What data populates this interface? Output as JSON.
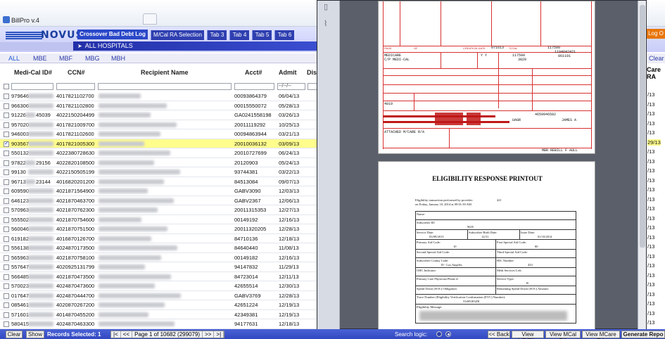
{
  "window": {
    "title": "BillPro v.4"
  },
  "header": {
    "logo_text": "NOVUS",
    "active_tab": "Crossover Bad Debt Log",
    "tabs": [
      "M/Cal RA Selection",
      "Tab 3",
      "Tab 4",
      "Tab 5",
      "Tab 6"
    ],
    "scope": "ALL HOSPITALS",
    "logout": "Log O"
  },
  "subtabs": [
    "ALL",
    "MBE",
    "MBF",
    "MBG",
    "MBH"
  ],
  "table": {
    "headers": [
      "Medi-Cal ID#",
      "CCN#",
      "Recipient Name",
      "Acct#",
      "Admit",
      "Dis"
    ],
    "filter_placeholder": "--/--/--",
    "rows": [
      {
        "id": "979646",
        "ccn": "4017821102700",
        "acct": "00093864379",
        "admit": "06/04/13",
        "checked": false
      },
      {
        "id": "966306",
        "ccn": "4017821102800",
        "acct": "00015550072",
        "admit": "05/28/13",
        "checked": false
      },
      {
        "id": "91226",
        "id2": "45039",
        "ccn": "4022150204499",
        "acct": "GA0241558198",
        "admit": "03/26/13",
        "checked": false
      },
      {
        "id": "957020",
        "ccn": "4017821009700",
        "acct": "20011119292",
        "admit": "10/25/13",
        "checked": false
      },
      {
        "id": "946003",
        "ccn": "4017821102600",
        "acct": "00094863944",
        "admit": "03/21/13",
        "checked": false
      },
      {
        "id": "903567",
        "ccn": "4017821005300",
        "acct": "20010036132",
        "admit": "03/09/13",
        "checked": true
      },
      {
        "id": "550132",
        "ccn": "4022380728630",
        "acct": "20010727699",
        "admit": "06/24/13",
        "checked": false
      },
      {
        "id": "97822",
        "id2": "29156",
        "ccn": "4022820108500",
        "acct": "20120903",
        "admit": "05/24/13",
        "checked": false
      },
      {
        "id": "99130",
        "ccn": "4022150505199",
        "acct": "93744381",
        "admit": "03/22/13",
        "checked": false
      },
      {
        "id": "96713",
        "id2": "23144",
        "ccn": "4016820201200",
        "acct": "84513084",
        "admit": "09/07/13",
        "checked": false
      },
      {
        "id": "609590",
        "ccn": "4021871564900",
        "acct": "GABV3090",
        "admit": "12/03/13",
        "checked": false
      },
      {
        "id": "646123",
        "ccn": "4021870463700",
        "acct": "GABV2367",
        "admit": "12/06/13",
        "checked": false
      },
      {
        "id": "570963",
        "ccn": "4021870762300",
        "acct": "20011315353",
        "admit": "12/27/13",
        "checked": false
      },
      {
        "id": "555502",
        "ccn": "4021870754600",
        "acct": "00149192",
        "admit": "12/16/13",
        "checked": false
      },
      {
        "id": "560046",
        "ccn": "4021870751500",
        "acct": "20011320205",
        "admit": "12/28/13",
        "checked": false
      },
      {
        "id": "619182",
        "ccn": "4016870126700",
        "acct": "84710136",
        "admit": "12/18/13",
        "checked": false
      },
      {
        "id": "556138",
        "ccn": "4024870173500",
        "acct": "84640440",
        "admit": "11/08/13",
        "checked": false
      },
      {
        "id": "565963",
        "ccn": "4021870758100",
        "acct": "00149182",
        "admit": "12/16/13",
        "checked": false
      },
      {
        "id": "557647",
        "ccn": "4020925131799",
        "acct": "94147832",
        "admit": "11/29/13",
        "checked": false
      },
      {
        "id": "566485",
        "ccn": "4021870473500",
        "acct": "84723014",
        "admit": "12/11/13",
        "checked": false
      },
      {
        "id": "570023",
        "ccn": "4024870473600",
        "acct": "42655514",
        "admit": "12/30/13",
        "checked": false
      },
      {
        "id": "017647",
        "ccn": "4024870444700",
        "acct": "GABV3769",
        "admit": "12/28/13",
        "checked": false
      },
      {
        "id": "085461",
        "ccn": "4020870267200",
        "acct": "42651224",
        "admit": "12/19/13",
        "checked": false
      },
      {
        "id": "571601",
        "ccn": "4014870455200",
        "acct": "42349381",
        "admit": "12/19/13",
        "checked": false
      },
      {
        "id": "580415",
        "ccn": "4024870463300",
        "acct": "94177631",
        "admit": "12/18/13",
        "checked": false
      }
    ]
  },
  "right_column": {
    "header_lines": [
      "Care",
      "RA"
    ],
    "values": [
      "/13",
      "/13",
      "/13",
      "/13",
      "/13",
      "29/13",
      "/13",
      "/13",
      "/13",
      "/13",
      "/13",
      "/13",
      "/13",
      "/13",
      "/13",
      "/13",
      "/13",
      "/13",
      "/13",
      "/13",
      "/13",
      "/13",
      "/13",
      "/13",
      "/13"
    ]
  },
  "pdf": {
    "claim": {
      "payer_line1": "MEDICARE",
      "payer_line2": "C/P MEDI-CAL",
      "creation_date_label": "CREATION DATE",
      "creation_date": "071613",
      "total_label": "TOTAL",
      "amount1": "117500",
      "amount2": "117500",
      "amount3": "3820",
      "npi": "1194842421",
      "code1": "061191",
      "code2": "4659946582",
      "code3": "4019",
      "provider": "UAGR",
      "name_short": "JAMES A",
      "attached": "ATTACHED M/CARE R/A",
      "rebill": "MBR REBILL F AULL"
    },
    "eligibility": {
      "title": "ELIGIBILITY RESPONSE PRINTOUT",
      "performed_by": "Eligibility transaction performed by provider:",
      "provider_no": "421",
      "performed_on": "on Friday, January 10, 2014 at 09:01:39 AM",
      "name_label": "Name:",
      "subscriber_id_label": "Subscriber ID:",
      "subscriber_id": "9635",
      "service_date_label": "Service Date:",
      "service_date": "03/09/2013",
      "birth_date_label": "Subscriber Birth Date:",
      "birth_date": "12/31",
      "issue_date_label": "Issue Date:",
      "issue_date": "01/10/2014",
      "primary_aid_label": "Primary Aid Code:",
      "primary_aid": "10",
      "first_special_label": "First Special Aid Code:",
      "first_special": "80",
      "second_special_label": "Second Special Aid Code:",
      "third_special_label": "Third Special Aid Code:",
      "county_label": "Subscriber County Code:",
      "county": "19 - Los Angeles",
      "hic_label": "HIC Number:",
      "hic": "433",
      "ohc_label": "OHC Indicator:",
      "medi_services_label": "Medi Services Left:",
      "pcp_label": "Primary Care Physician Phone #:",
      "service_type_label": "Service Type:",
      "service_type": "R",
      "soc_label": "Spend Down (SOC) Obligation:",
      "remaining_soc_label": "Remaining Spend Down (SOC) Amount:",
      "trace_label": "Trace Number (Eligibility Verification Confirmation (EVC) Number):",
      "trace": "53495J03ZB",
      "message_label": "Eligibility Message:"
    }
  },
  "bottom": {
    "clear": "Clear",
    "show": "Show",
    "records_selected": "Records Selected: 1",
    "pager_first": "|<",
    "pager_prev": "<<",
    "page_info": "Page 1 of 10682 (299079)",
    "pager_next": ">>",
    "pager_last": ">|",
    "search_logic": "Search logic:",
    "back": "<< Back",
    "view_ub": "View UB/Elig",
    "view_mcal": "View MCal RA",
    "view_mcare": "View MCare RA",
    "generate": "Generate Repo"
  },
  "colors": {
    "accent": "#2a48c8",
    "highlight": "#fffd8c",
    "logout": "#e8760a",
    "form_red": "#d83030"
  }
}
